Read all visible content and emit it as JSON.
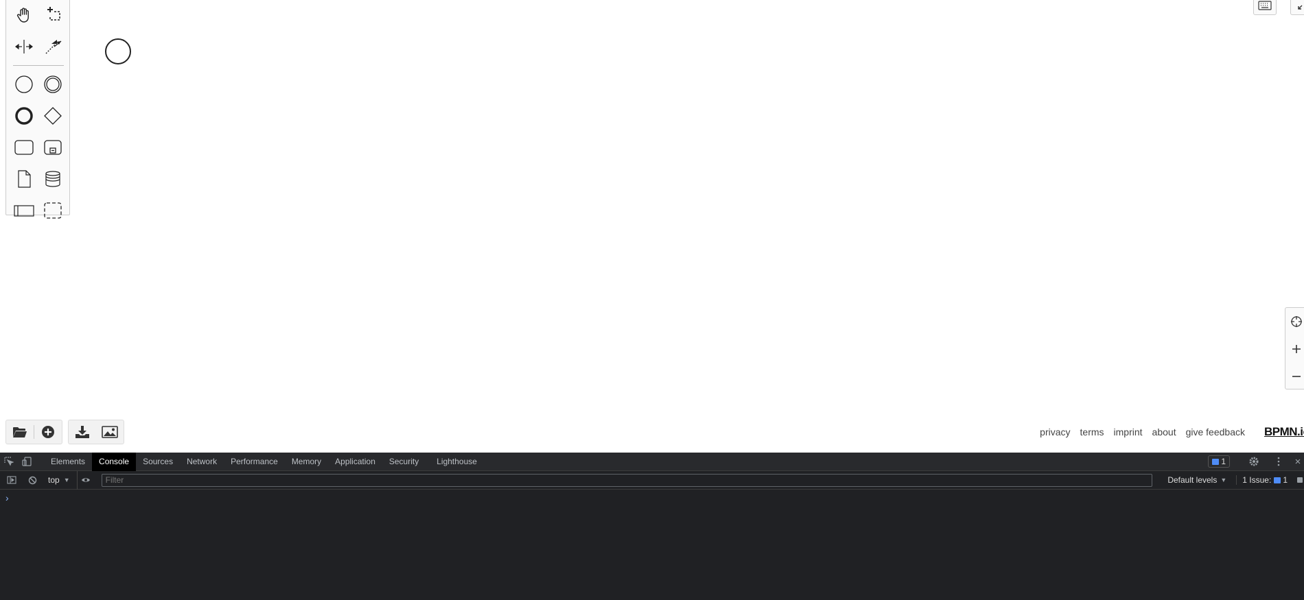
{
  "palette": {
    "tools": [
      "hand-tool-icon",
      "lasso-tool-icon",
      "space-tool-icon",
      "global-connect-tool-icon"
    ],
    "shapes": [
      "start-event-icon",
      "intermediate-event-icon",
      "end-event-icon",
      "gateway-icon",
      "task-icon",
      "subprocess-icon",
      "data-object-icon",
      "data-store-icon",
      "participant-icon",
      "group-icon"
    ]
  },
  "actions": {
    "open": "folder-icon",
    "create": "plus-circle-icon",
    "download": "download-icon",
    "export_image": "image-icon"
  },
  "footer": {
    "links": [
      "privacy",
      "terms",
      "imprint",
      "about",
      "give feedback"
    ],
    "brand": "BPMN.io"
  },
  "devtools": {
    "tabs": [
      "Elements",
      "Console",
      "Sources",
      "Network",
      "Performance",
      "Memory",
      "Application",
      "Security",
      "Lighthouse"
    ],
    "active_tab": "Console",
    "issues_badge": "1",
    "context": "top",
    "filter_placeholder": "Filter",
    "levels": "Default levels",
    "issues_label": "1 Issue:",
    "issues_count": "1",
    "prompt": "›"
  },
  "colors": {
    "accent": "#4f8cf7",
    "devtools_bg": "#202124"
  }
}
